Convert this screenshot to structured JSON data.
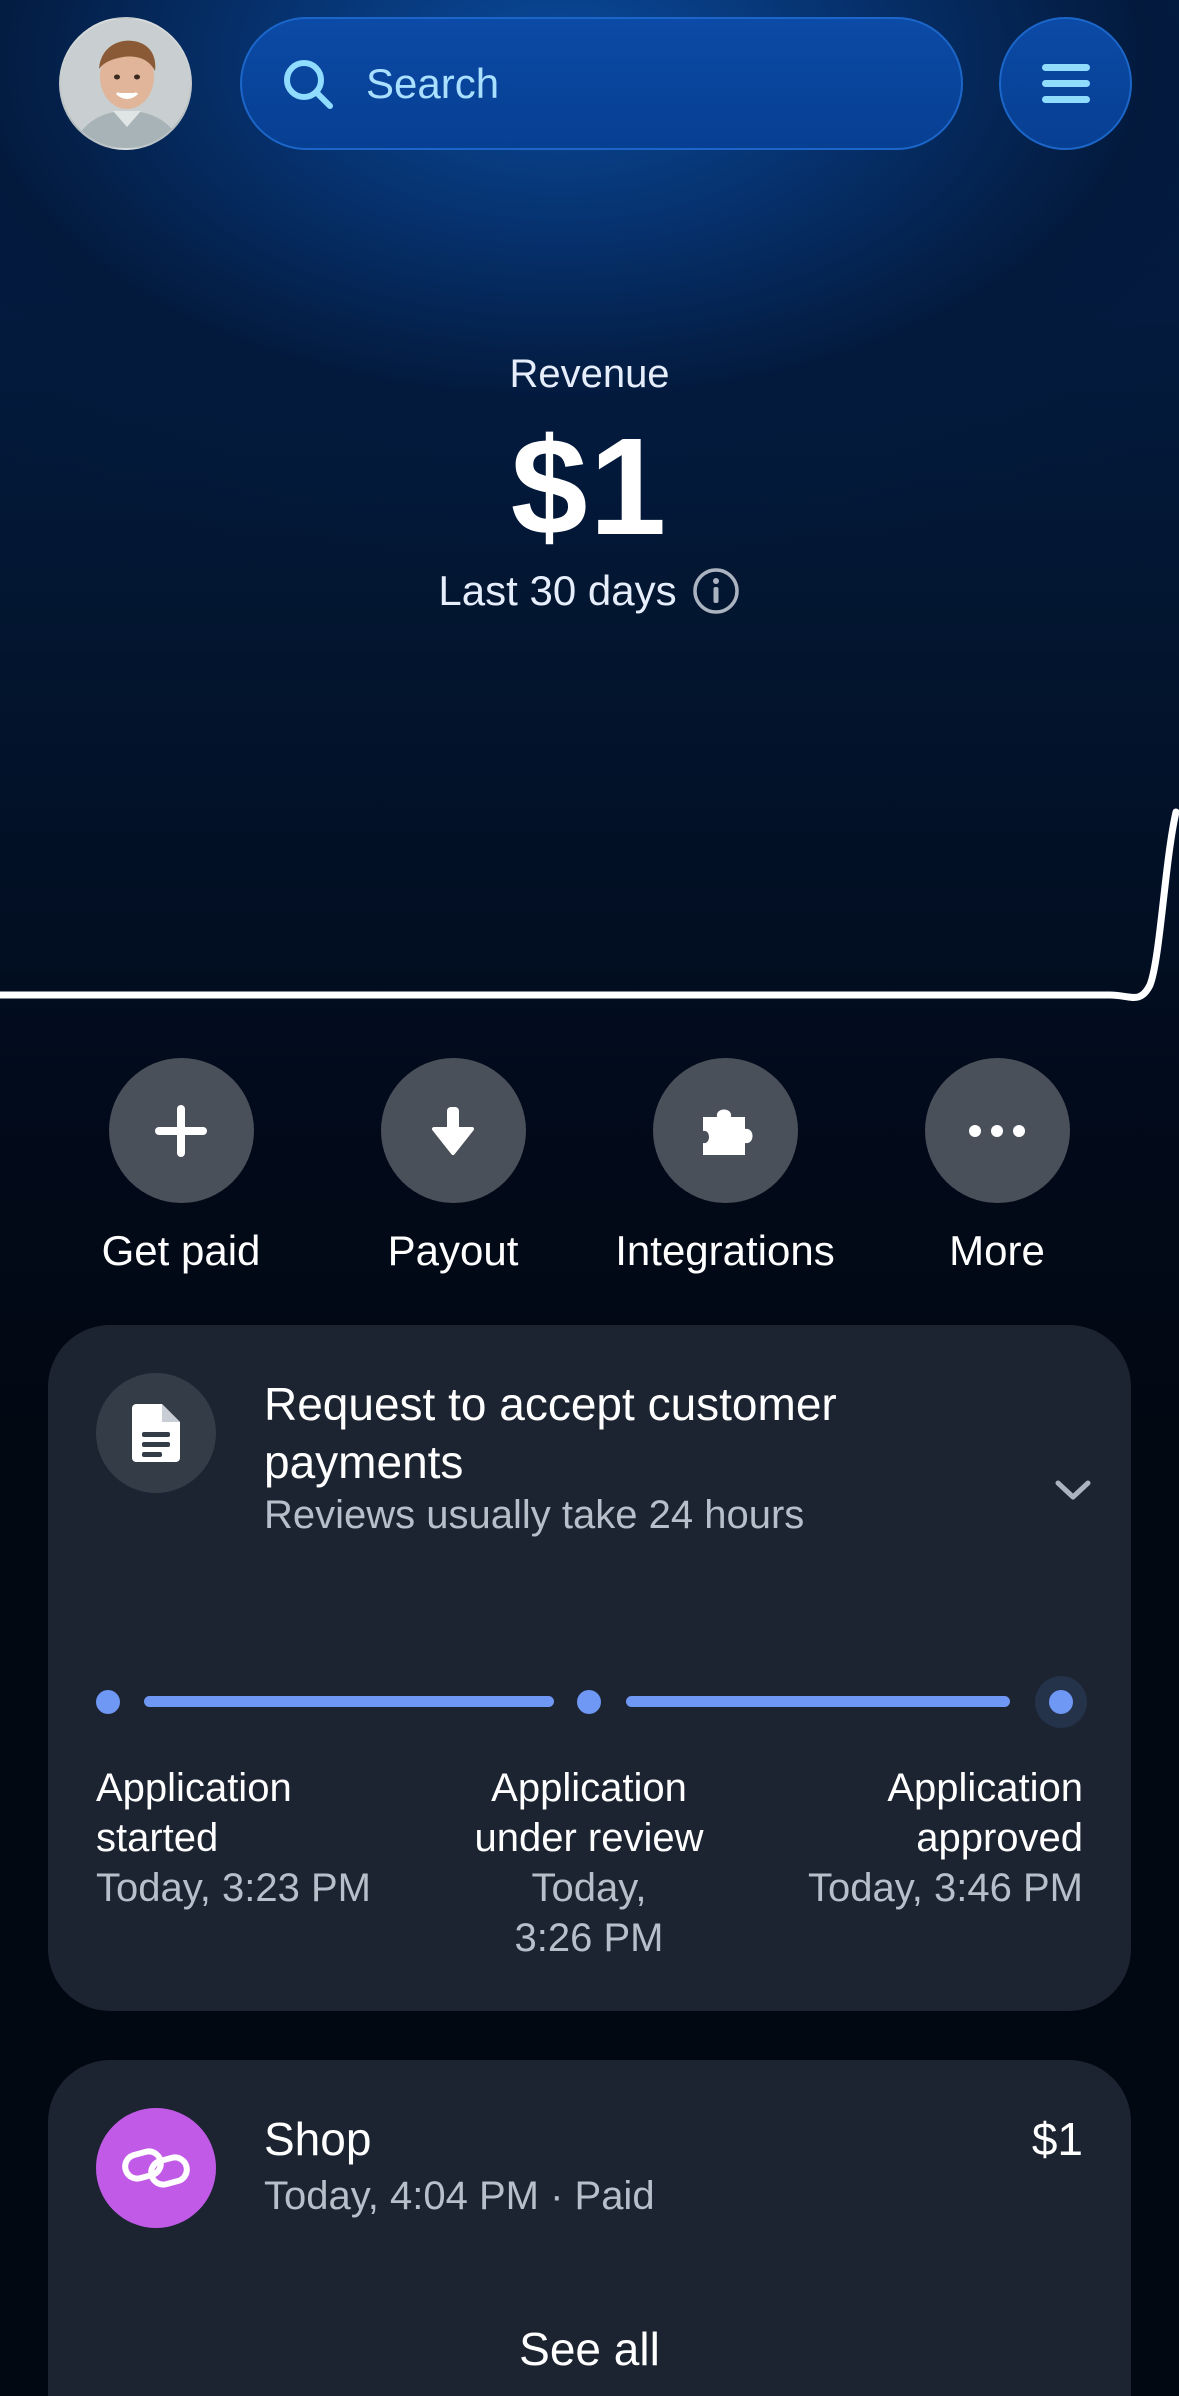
{
  "header": {
    "search_placeholder": "Search",
    "icons": {
      "avatar": "user-avatar",
      "search": "search-icon",
      "menu": "hamburger-menu-icon"
    }
  },
  "revenue": {
    "title": "Revenue",
    "amount": "$1",
    "period": "Last 30 days"
  },
  "actions": [
    {
      "label": "Get paid",
      "icon": "plus-icon"
    },
    {
      "label": "Payout",
      "icon": "download-arrow-icon"
    },
    {
      "label": "Integrations",
      "icon": "puzzle-icon"
    },
    {
      "label": "More",
      "icon": "more-dots-icon"
    }
  ],
  "request_card": {
    "title": "Request to accept customer payments",
    "subtitle": "Reviews usually take 24 hours",
    "steps": [
      {
        "name": "Application started",
        "time": "Today, 3:23 PM"
      },
      {
        "name": "Application under review",
        "time": "Today, 3:26 PM"
      },
      {
        "name": "Application approved",
        "time": "Today, 3:46 PM"
      }
    ]
  },
  "transactions": {
    "items": [
      {
        "name": "Shop",
        "detail": "Today, 4:04 PM · Paid",
        "amount": "$1",
        "icon": "link-icon"
      }
    ],
    "see_all_label": "See all"
  },
  "colors": {
    "accent": "#6f97f4",
    "card_bg": "#1c2431",
    "shop_icon_bg": "#c25ae8",
    "search_bg": "#0a47a0"
  }
}
